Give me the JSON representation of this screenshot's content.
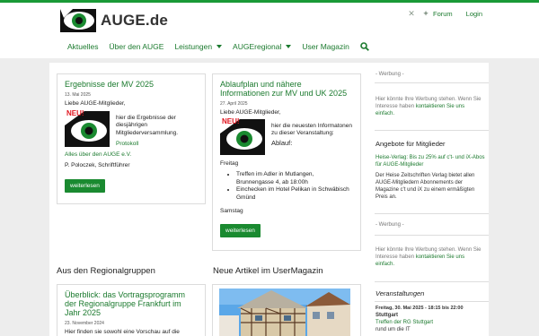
{
  "brand": {
    "logo_text": "AUGE",
    "logo_domain": ".de",
    "accent": "#1a9a37"
  },
  "toplinks": {
    "forum": "Forum",
    "login": "Login"
  },
  "top_icons": [
    "xing-icon",
    "twitter-icon"
  ],
  "nav": {
    "items": [
      {
        "label": "Aktuelles",
        "dropdown": false
      },
      {
        "label": "Über den AUGE",
        "dropdown": false
      },
      {
        "label": "Leistungen",
        "dropdown": true
      },
      {
        "label": "AUGEregional",
        "dropdown": true
      },
      {
        "label": "User Magazin",
        "dropdown": false
      }
    ]
  },
  "card1": {
    "title": "Ergebnisse der MV 2025",
    "date": "13. Mai 2025",
    "greeting": "Liebe AUGE-Mitglieder,",
    "neu": "NEU!",
    "body": "hier die Ergebnisse der diesjährigen Mitgliederversammlung.",
    "link": "Protokoll",
    "footer_link": "Alles über den AUGE e.V.",
    "signature": "P. Poloczek, Schriftführer",
    "button": "weiterlesen"
  },
  "card2": {
    "title": "Ablaufplan und nähere Informationen zur MV und UK 2025",
    "date": "27. April 2025",
    "greeting": "Liebe AUGE-Mitglieder,",
    "neu": "NEU!",
    "body": "hier die neuesten Informatonen zu dieser Veranstaltung:",
    "subhead": "Ablauf:",
    "day1": "Freitag",
    "bullets": [
      "Treffen im Adler in Mutlangen, Brunnengasse 4, ab 18:00h",
      "Einchecken im Hotel Pelikan in Schwäbisch Gmünd"
    ],
    "day2": "Samstag",
    "button": "weiterlesen"
  },
  "sections": {
    "regional": "Aus den Regionalgruppen",
    "magazin": "Neue Artikel im UserMagazin"
  },
  "card3": {
    "title": "Überblick: das Vortragsprogramm der Regionalgruppe Frankfurt im Jahr 2025",
    "date": "23. November 2024",
    "body": "Hier finden sie sowohl eine Vorschau auf die"
  },
  "sidebar": {
    "ad_label": "- Werbung -",
    "ad_text": "Hier könnte Ihre Werbung stehen. Wenn Sie Interesse haben",
    "ad_link": "kontaktieren Sie uns einfach.",
    "offers_title": "Angebote für Mitglieder",
    "offer_link": "Heise-Verlag: Bis zu 25% auf c't- und iX-Abos für AUGE-Mitglieder",
    "offer_text": "Der Heise Zeitschriften Verlag bietet allen AUGE-Mitgliedern Abonnements der Magazine c't und iX zu einem ermäßigten Preis an.",
    "ad2_label": "- Werbung -",
    "ad2_text": "Hier könnte Ihre Werbung stehen. Wenn Sie Interesse haben",
    "ad2_link": "kontaktieren Sie uns einfach.",
    "events_title": "Veranstaltungen",
    "event_date": "Freitag, 30. Mai 2025 - 18:15 bis 22:00",
    "event_city": "Stuttgart",
    "event_link": "Treffen der RG Stuttgart",
    "event_text": "rund um die IT"
  }
}
